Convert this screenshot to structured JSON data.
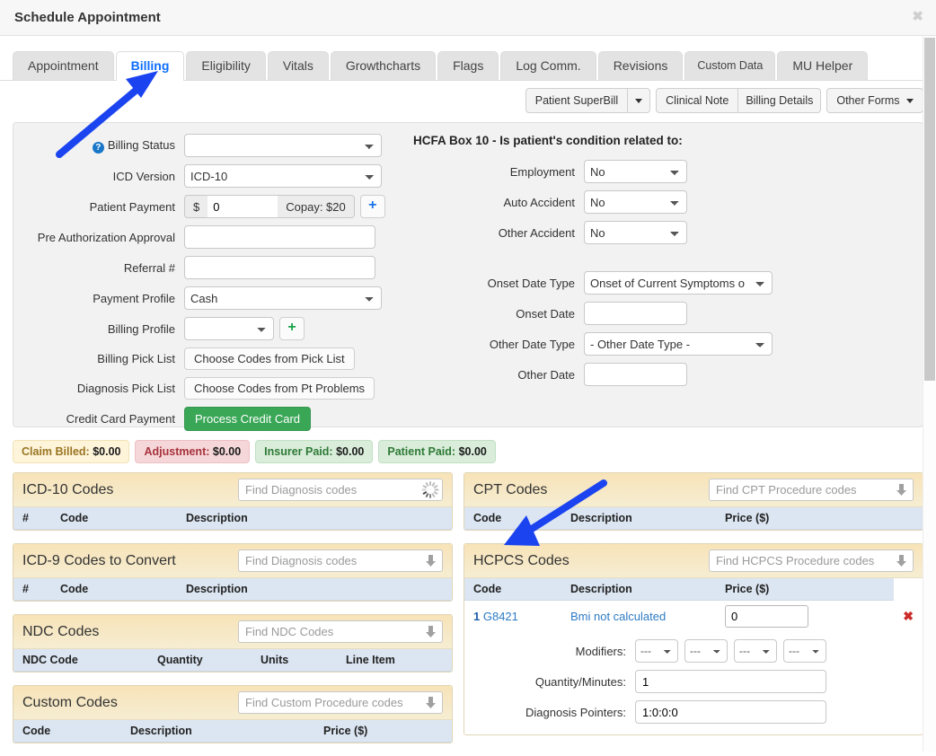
{
  "window": {
    "title": "Schedule Appointment",
    "close_label": "✖"
  },
  "tabs": [
    {
      "label": "Appointment",
      "active": false
    },
    {
      "label": "Billing",
      "active": true
    },
    {
      "label": "Eligibility",
      "active": false
    },
    {
      "label": "Vitals",
      "active": false
    },
    {
      "label": "Growthcharts",
      "active": false
    },
    {
      "label": "Flags",
      "active": false
    },
    {
      "label": "Log Comm.",
      "active": false
    },
    {
      "label": "Revisions",
      "active": false
    },
    {
      "label": "Custom Data",
      "active": false
    },
    {
      "label": "MU Helper",
      "active": false
    }
  ],
  "forms_toolbar": {
    "superbill": "Patient SuperBill",
    "superbill_caret": "▼",
    "clinical_note": "Clinical Note",
    "billing_details": "Billing Details",
    "other_forms": "Other Forms"
  },
  "billing_form": {
    "billing_status": {
      "label": "Billing Status",
      "value": "",
      "help_icon": "?"
    },
    "icd_version": {
      "label": "ICD Version",
      "value": "ICD-10"
    },
    "patient_payment": {
      "label": "Patient Payment",
      "currency": "$",
      "value": "0",
      "copay": "Copay: $20",
      "add": "+"
    },
    "pre_auth": {
      "label": "Pre Authorization Approval",
      "value": ""
    },
    "referral": {
      "label": "Referral #",
      "value": ""
    },
    "payment_profile": {
      "label": "Payment Profile",
      "value": "Cash"
    },
    "billing_profile": {
      "label": "Billing Profile",
      "value": "",
      "add": "+"
    },
    "billing_pick_list": {
      "label": "Billing Pick List",
      "button": "Choose Codes from Pick List"
    },
    "diagnosis_pick_list": {
      "label": "Diagnosis Pick List",
      "button": "Choose Codes from Pt Problems"
    },
    "credit_card": {
      "label": "Credit Card Payment",
      "button": "Process Credit Card"
    }
  },
  "hcfa": {
    "title": "HCFA Box 10 - Is patient's condition related to:",
    "employment": {
      "label": "Employment",
      "value": "No"
    },
    "auto_accident": {
      "label": "Auto Accident",
      "value": "No"
    },
    "other_accident": {
      "label": "Other Accident",
      "value": "No"
    },
    "onset_date_type": {
      "label": "Onset Date Type",
      "value": "Onset of Current Symptoms o"
    },
    "onset_date": {
      "label": "Onset Date",
      "value": ""
    },
    "other_date_type": {
      "label": "Other Date Type",
      "value": "- Other Date Type -"
    },
    "other_date": {
      "label": "Other Date",
      "value": ""
    }
  },
  "badges": [
    {
      "label": "Claim Billed:",
      "amount": "$0.00",
      "style": "b-billed"
    },
    {
      "label": "Adjustment:",
      "amount": "$0.00",
      "style": "b-adj"
    },
    {
      "label": "Insurer Paid:",
      "amount": "$0.00",
      "style": "b-ins"
    },
    {
      "label": "Patient Paid:",
      "amount": "$0.00",
      "style": "b-pat"
    }
  ],
  "panels": {
    "icd10": {
      "title": "ICD-10 Codes",
      "search_placeholder": "Find Diagnosis codes",
      "columns": [
        "#",
        "Code",
        "Description"
      ],
      "rows": []
    },
    "icd9": {
      "title": "ICD-9 Codes to Convert",
      "search_placeholder": "Find Diagnosis codes",
      "columns": [
        "#",
        "Code",
        "Description"
      ],
      "rows": []
    },
    "ndc": {
      "title": "NDC Codes",
      "search_placeholder": "Find NDC Codes",
      "columns": [
        "NDC Code",
        "Quantity",
        "Units",
        "Line Item"
      ],
      "rows": []
    },
    "custom": {
      "title": "Custom Codes",
      "search_placeholder": "Find Custom Procedure codes",
      "columns": [
        "Code",
        "Description",
        "Price ($)"
      ],
      "rows": []
    },
    "cpt": {
      "title": "CPT Codes",
      "search_placeholder": "Find CPT Procedure codes",
      "columns": [
        "Code",
        "Description",
        "Price ($)"
      ],
      "rows": []
    },
    "hcpcs": {
      "title": "HCPCS Codes",
      "search_placeholder": "Find HCPCS Procedure codes",
      "columns": [
        "Code",
        "Description",
        "Price ($)"
      ],
      "row": {
        "num": "1",
        "code": "G8421",
        "description": "Bmi not calculated",
        "price": "0",
        "delete": "✖"
      },
      "modifiers": {
        "label": "Modifiers:",
        "values": [
          "---",
          "---",
          "---",
          "---"
        ]
      },
      "quantity": {
        "label": "Quantity/Minutes:",
        "value": "1"
      },
      "diagnosis_pointers": {
        "label": "Diagnosis Pointers:",
        "value": "1:0:0:0"
      }
    }
  },
  "annotations": {
    "arrow_color": "#1b44f0",
    "arrow1_target": "Billing tab",
    "arrow2_target": "HCPCS Codes panel"
  }
}
